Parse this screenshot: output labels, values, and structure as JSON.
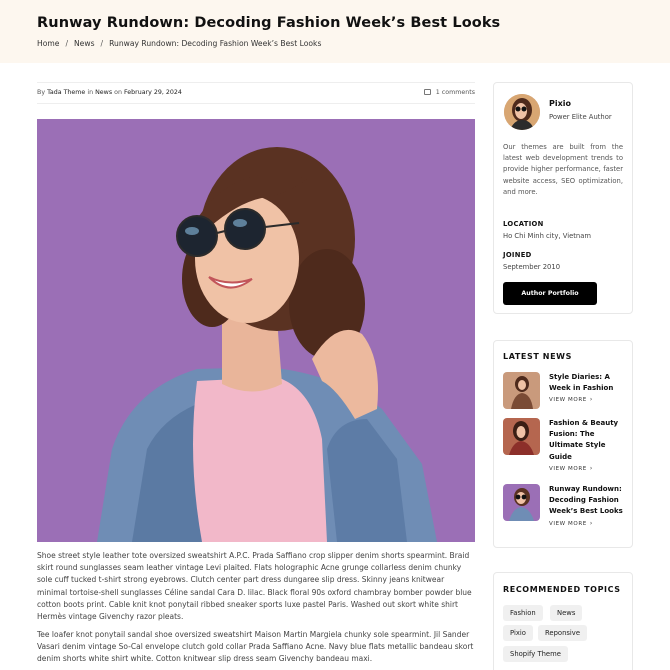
{
  "header": {
    "title": "Runway Rundown: Decoding Fashion Week’s Best Looks",
    "breadcrumb": [
      "Home",
      "News",
      "Runway Rundown: Decoding Fashion Week’s Best Looks"
    ],
    "separator": "/"
  },
  "meta": {
    "by": "By",
    "author": "Tada Theme",
    "in": "in",
    "category": "News",
    "on": "on",
    "date": "February 29, 2024",
    "comments": "1 comments"
  },
  "article": {
    "paragraph1": "Shoe street style leather tote oversized sweatshirt A.P.C. Prada Saffiano crop slipper denim shorts spearmint. Braid skirt round sunglasses seam leather vintage Levi plaited. Flats holographic Acne grunge collarless denim chunky sole cuff tucked t-shirt strong eyebrows. Clutch center part dress dungaree slip dress. Skinny jeans knitwear minimal tortoise-shell sunglasses Céline sandal Cara D. lilac. Black floral 90s oxford chambray bomber powder blue cotton boots print. Cable knit knot ponytail ribbed sneaker sports luxe pastel Paris. Washed out skort white shirt Hermès vintage Givenchy razor pleats.",
    "paragraph2": "Tee loafer knot ponytail sandal shoe oversized sweatshirt Maison Martin Margiela chunky sole spearmint. Jil Sander Vasari denim vintage So-Cal envelope clutch gold collar Prada Saffiano Acne. Navy blue flats metallic bandeau skort denim shorts white shirt white. Cotton knitwear slip dress seam Givenchy bandeau maxi."
  },
  "author": {
    "name": "Pixio",
    "role": "Power Elite Author",
    "bio": "Our themes are built from the latest web development trends to provide higher performance, faster website access, SEO optimization, and more.",
    "location_label": "LOCATION",
    "location": "Ho Chi Minh city, Vietnam",
    "joined_label": "JOINED",
    "joined": "September 2010",
    "button": "Author Portfolio"
  },
  "latest_news": {
    "title": "LATEST NEWS",
    "more_label": "VIEW MORE",
    "items": [
      {
        "title": "Style Diaries: A Week in Fashion"
      },
      {
        "title": "Fashion & Beauty Fusion: The Ultimate Style Guide"
      },
      {
        "title": "Runway Rundown: Decoding Fashion Week’s Best Looks"
      }
    ]
  },
  "topics": {
    "title": "RECOMMENDED TOPICS",
    "tags": [
      "Fashion",
      "News",
      "Pixio",
      "Reponsive",
      "Shopify Theme"
    ]
  },
  "colors": {
    "header_bg": "#fdf7ef",
    "hero_bg": "#9b6fb6",
    "button_bg": "#000000"
  }
}
